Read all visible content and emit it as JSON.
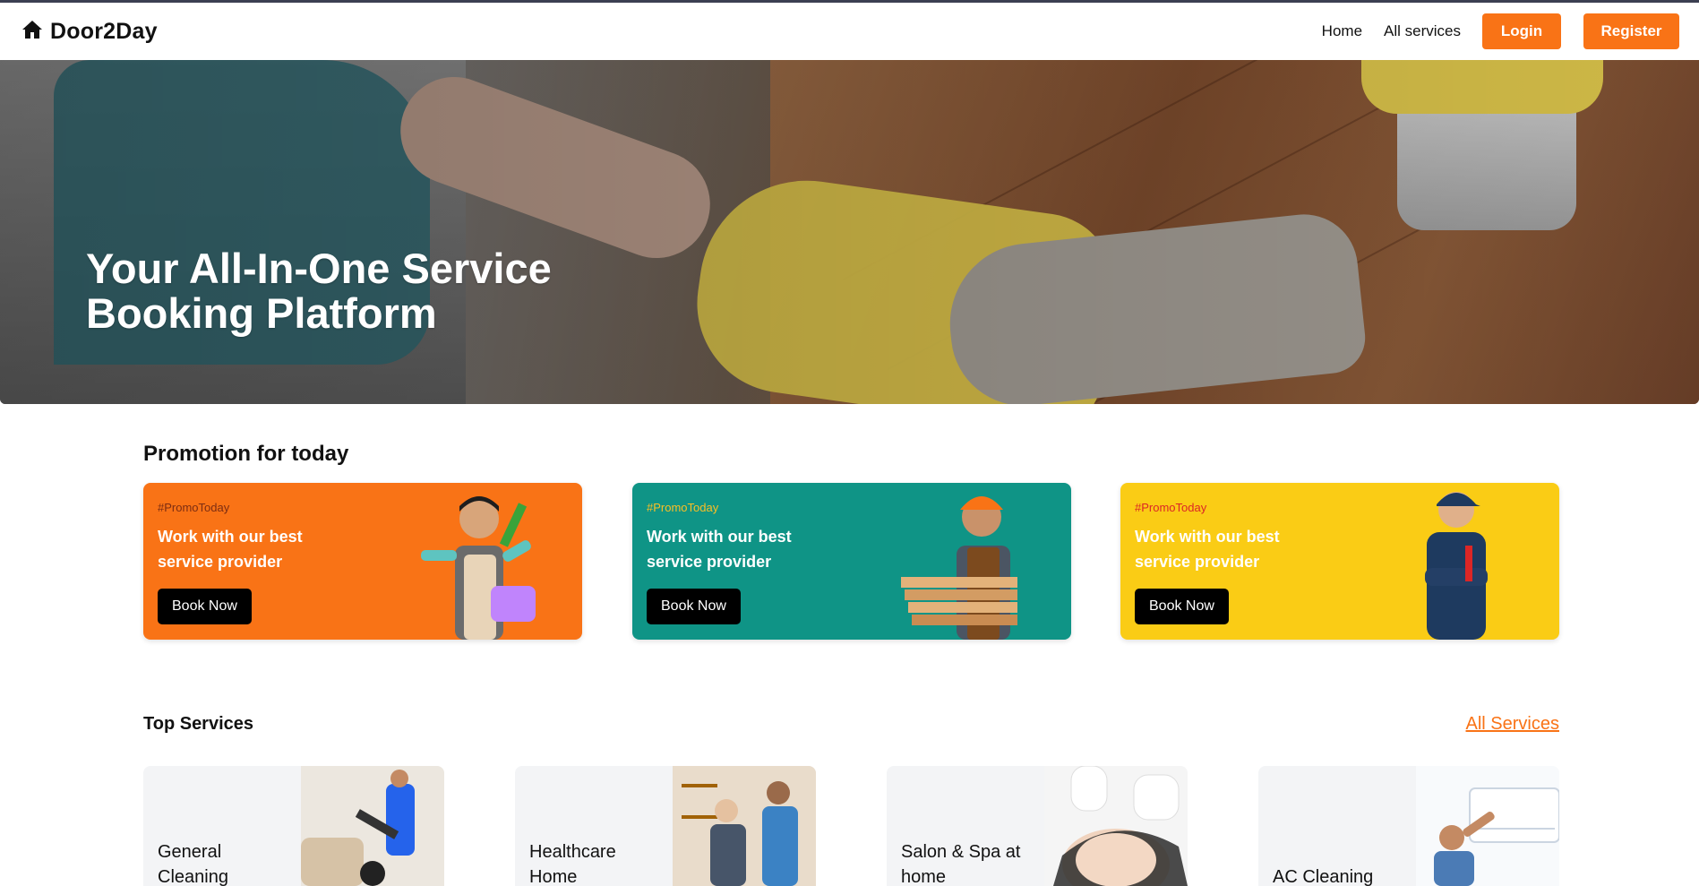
{
  "brand": {
    "name": "Door2Day",
    "icon": "home-icon"
  },
  "nav": {
    "home": "Home",
    "all_services": "All services",
    "login": "Login",
    "register": "Register"
  },
  "colors": {
    "accent": "#f97316",
    "teal": "#0f9486",
    "yellow": "#facc15"
  },
  "hero": {
    "title": "Your All-In-One Service Booking Platform"
  },
  "promotions": {
    "title": "Promotion for today",
    "cards": [
      {
        "tag": "#PromoToday",
        "text": "Work with our best service provider",
        "button": "Book Now"
      },
      {
        "tag": "#PromoToday",
        "text": "Work with our best service provider",
        "button": "Book Now"
      },
      {
        "tag": "#PromoToday",
        "text": "Work with our best service provider",
        "button": "Book Now"
      }
    ]
  },
  "top_services": {
    "title": "Top Services",
    "all_link": "All Services",
    "items": [
      {
        "name": "General Cleaning"
      },
      {
        "name": "Healthcare Home"
      },
      {
        "name": "Salon & Spa at home"
      },
      {
        "name": "AC Cleaning"
      }
    ]
  }
}
